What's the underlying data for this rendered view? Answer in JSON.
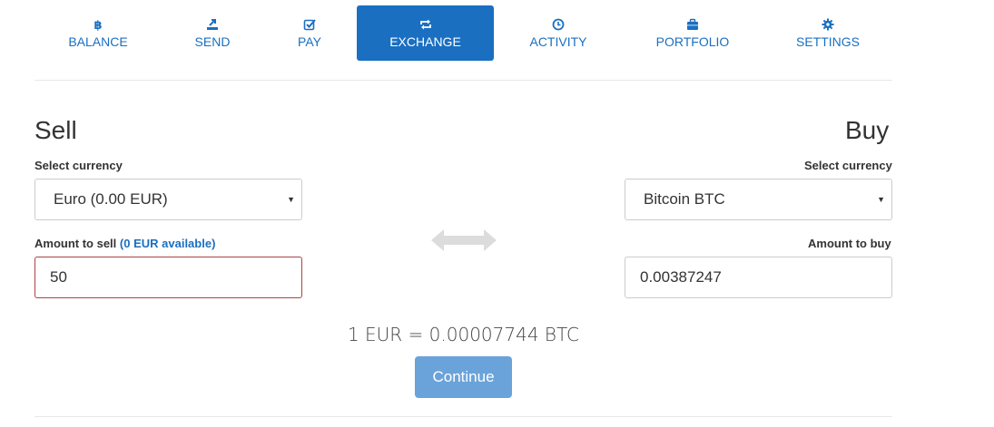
{
  "nav": {
    "items": [
      {
        "label": "BALANCE",
        "icon": "bitcoin-icon"
      },
      {
        "label": "SEND",
        "icon": "send-icon"
      },
      {
        "label": "PAY",
        "icon": "checkbox-icon"
      },
      {
        "label": "EXCHANGE",
        "icon": "exchange-icon",
        "active": true
      },
      {
        "label": "ACTIVITY",
        "icon": "clock-icon"
      },
      {
        "label": "PORTFOLIO",
        "icon": "briefcase-icon"
      },
      {
        "label": "SETTINGS",
        "icon": "gear-icon"
      }
    ]
  },
  "sell": {
    "title": "Sell",
    "currency_label": "Select currency",
    "currency_value": "Euro (0.00 EUR)",
    "amount_label": "Amount to sell",
    "amount_available": "(0 EUR available)",
    "amount_value": "50"
  },
  "buy": {
    "title": "Buy",
    "currency_label": "Select currency",
    "currency_value": "Bitcoin BTC",
    "amount_label": "Amount to buy",
    "amount_value": "0.00387247"
  },
  "rate": "1 EUR = 0.00007744 BTC",
  "continue_label": "Continue",
  "colors": {
    "accent": "#1a6fc1",
    "button": "#6aa3d9",
    "invalid_border": "#a94442"
  }
}
